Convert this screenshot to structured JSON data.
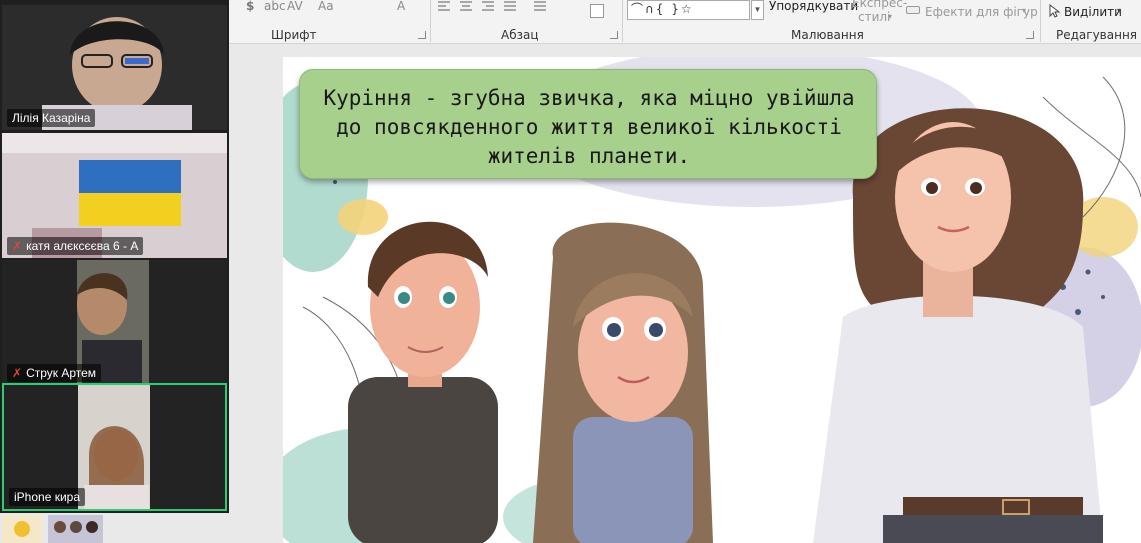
{
  "ribbon": {
    "groups": [
      {
        "label": "Шрифт"
      },
      {
        "label": "Абзац"
      },
      {
        "label": "Малювання"
      },
      {
        "label": "Редагування"
      }
    ],
    "font_items": [
      "$",
      "abc",
      "AV",
      "Aa",
      "A"
    ],
    "arrange_label": "Упорядкувати",
    "quick_styles_label_1": "Експрес-",
    "quick_styles_label_2": "стилі",
    "shape_effects_label": "Ефекти для фігур",
    "select_label": "Виділити",
    "shapes_preview": "⌒∩{ }☆"
  },
  "slide": {
    "banner_line_1": "Куріння - згубна звичка, яка міцно увійшла",
    "banner_line_2": "до повсякденного життя великої кількості",
    "banner_line_3": "жителів планети."
  },
  "participants": [
    {
      "name": "Лілія Казаріна",
      "muted": false
    },
    {
      "name": "катя алєксєєва 6 - А",
      "muted": true
    },
    {
      "name": "Струк Артем",
      "muted": true
    },
    {
      "name": "iPhone кира",
      "muted": false
    }
  ],
  "colors": {
    "banner_bg": "#a8d08d",
    "active_speaker_border": "#2ecc71",
    "muted_icon": "#e0433a"
  }
}
